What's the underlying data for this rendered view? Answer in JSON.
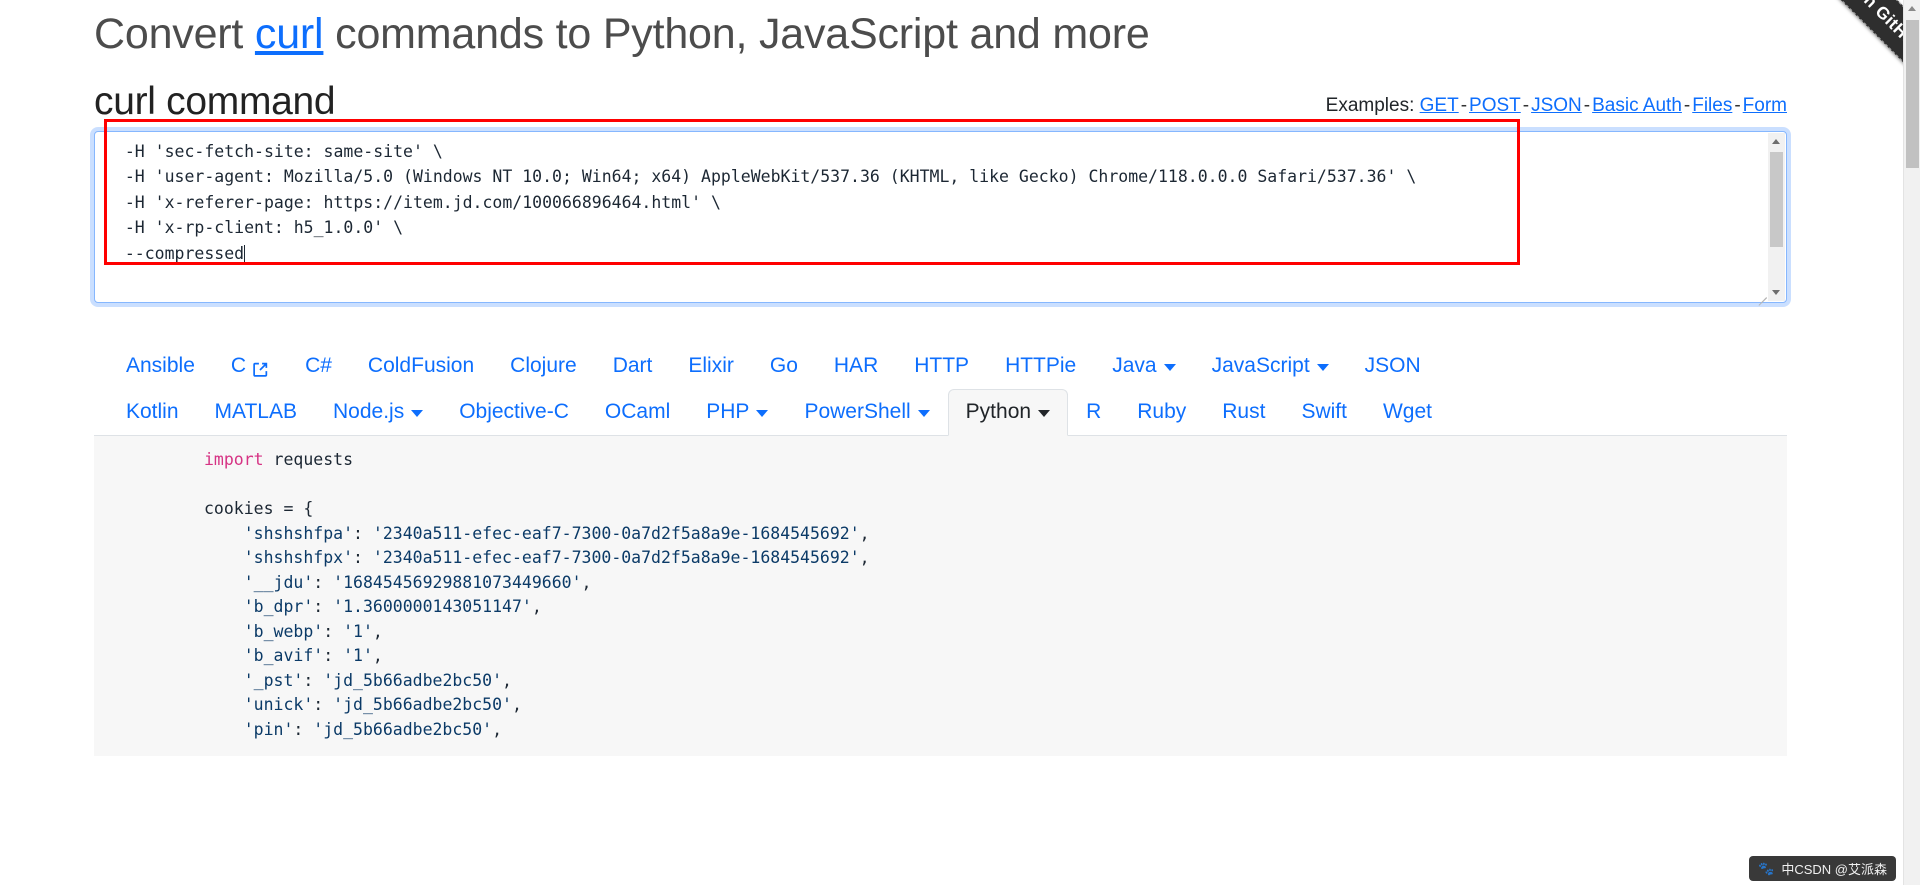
{
  "ribbon": {
    "label": "Fork me on GitHub"
  },
  "header": {
    "title_before": "Convert ",
    "title_link": "curl",
    "title_after": " commands to Python, JavaScript and more",
    "section_title": "curl command"
  },
  "examples": {
    "label": "Examples:",
    "separator": "-",
    "links": [
      "GET",
      "POST",
      "JSON",
      "Basic Auth",
      "Files",
      "Form"
    ]
  },
  "curl_input": {
    "value": "  -H 'sec-fetch-site: same-site' \\\n  -H 'user-agent: Mozilla/5.0 (Windows NT 10.0; Win64; x64) AppleWebKit/537.36 (KHTML, like Gecko) Chrome/118.0.0.0 Safari/537.36' \\\n  -H 'x-referer-page: https://item.jd.com/100066896464.html' \\\n  -H 'x-rp-client: h5_1.0.0' \\\n  --compressed"
  },
  "tabs": {
    "active": "Python",
    "row1": [
      {
        "label": "Ansible",
        "caret": false,
        "external": false
      },
      {
        "label": "C",
        "caret": false,
        "external": true
      },
      {
        "label": "C#",
        "caret": false,
        "external": false
      },
      {
        "label": "ColdFusion",
        "caret": false,
        "external": false
      },
      {
        "label": "Clojure",
        "caret": false,
        "external": false
      },
      {
        "label": "Dart",
        "caret": false,
        "external": false
      },
      {
        "label": "Elixir",
        "caret": false,
        "external": false
      },
      {
        "label": "Go",
        "caret": false,
        "external": false
      },
      {
        "label": "HAR",
        "caret": false,
        "external": false
      },
      {
        "label": "HTTP",
        "caret": false,
        "external": false
      },
      {
        "label": "HTTPie",
        "caret": false,
        "external": false
      },
      {
        "label": "Java",
        "caret": true,
        "external": false
      },
      {
        "label": "JavaScript",
        "caret": true,
        "external": false
      },
      {
        "label": "JSON",
        "caret": false,
        "external": false
      }
    ],
    "row2": [
      {
        "label": "Kotlin",
        "caret": false,
        "external": false
      },
      {
        "label": "MATLAB",
        "caret": false,
        "external": false
      },
      {
        "label": "Node.js",
        "caret": true,
        "external": false
      },
      {
        "label": "Objective-C",
        "caret": false,
        "external": false
      },
      {
        "label": "OCaml",
        "caret": false,
        "external": false
      },
      {
        "label": "PHP",
        "caret": true,
        "external": false
      },
      {
        "label": "PowerShell",
        "caret": true,
        "external": false
      },
      {
        "label": "Python",
        "caret": true,
        "external": false
      },
      {
        "label": "R",
        "caret": false,
        "external": false
      },
      {
        "label": "Ruby",
        "caret": false,
        "external": false
      },
      {
        "label": "Rust",
        "caret": false,
        "external": false
      },
      {
        "label": "Swift",
        "caret": false,
        "external": false
      },
      {
        "label": "Wget",
        "caret": false,
        "external": false
      }
    ]
  },
  "code_output": {
    "language": "Python",
    "lines": [
      "import requests",
      "",
      "cookies = {",
      "    'shshshfpa': '2340a511-efec-eaf7-7300-0a7d2f5a8a9e-1684545692',",
      "    'shshshfpx': '2340a511-efec-eaf7-7300-0a7d2f5a8a9e-1684545692',",
      "    '__jdu': '16845456929881073449660',",
      "    'b_dpr': '1.3600000143051147',",
      "    'b_webp': '1',",
      "    'b_avif': '1',",
      "    '_pst': 'jd_5b66adbe2bc50',",
      "    'unick': 'jd_5b66adbe2bc50',",
      "    'pin': 'jd_5b66adbe2bc50',"
    ]
  },
  "watermark": {
    "text": "中CSDN @艾派森"
  },
  "colors": {
    "link": "#0d6efd",
    "annotation": "#ff0000",
    "code_keyword": "#d63384",
    "code_string": "#0b3a67",
    "tab_active_bg": "#f7f7f7"
  }
}
